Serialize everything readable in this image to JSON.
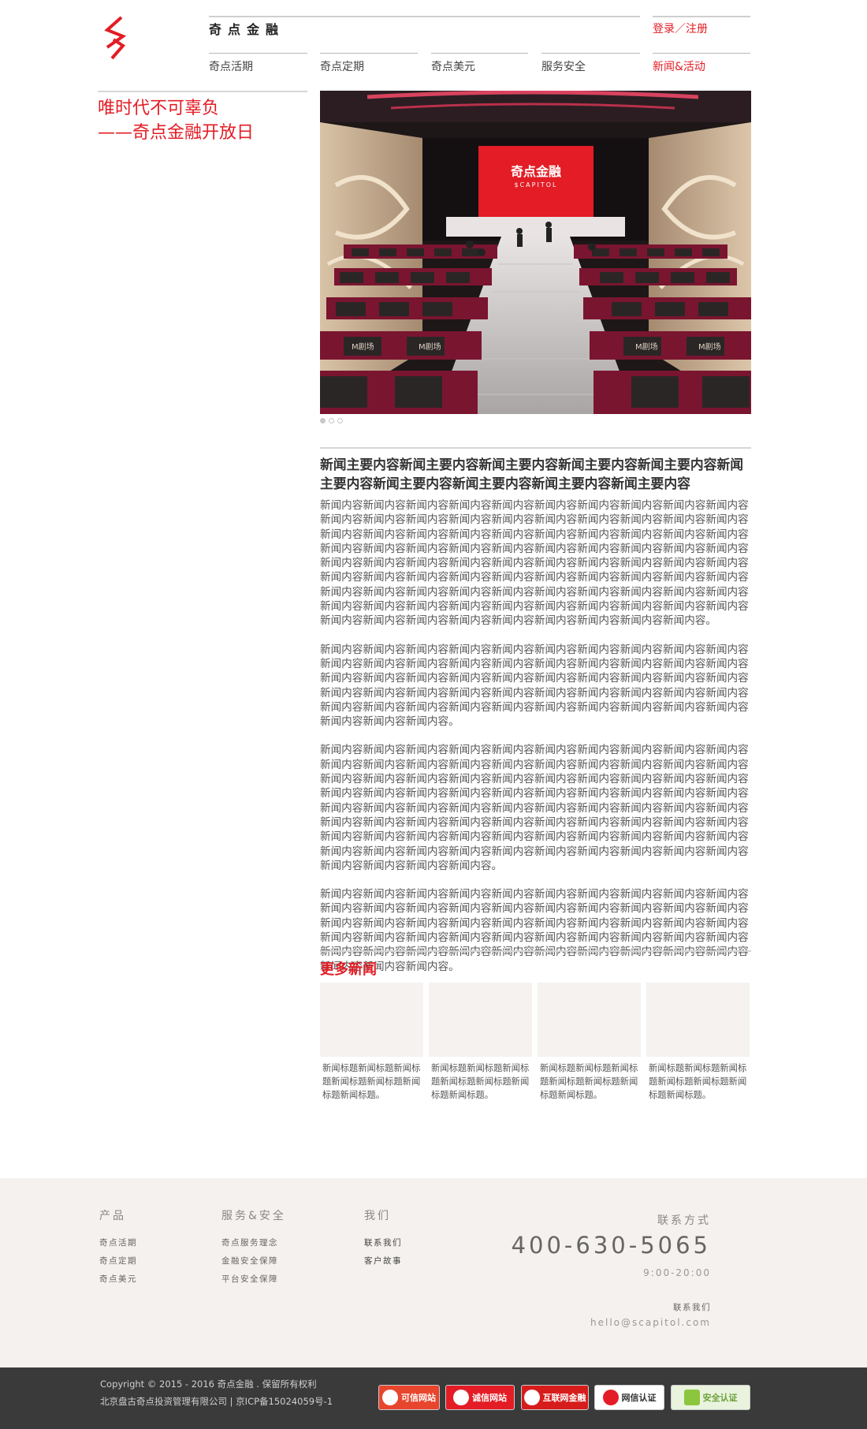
{
  "header": {
    "brand": "奇点金融",
    "login": "登录／注册",
    "nav": [
      "奇点活期",
      "奇点定期",
      "奇点美元",
      "服务安全",
      "新闻&活动"
    ]
  },
  "slogan": {
    "line1": "唯时代不可辜负",
    "line2": "——奇点金融开放日"
  },
  "hero": {
    "screen_title": "奇点金融",
    "screen_sub": "$CAPITOL",
    "seat_label": "M剧场"
  },
  "article": {
    "title": "新闻主要内容新闻主要内容新闻主要内容新闻主要内容新闻主要内容新闻主要内容新闻主要内容新闻主要内容新闻主要内容新闻主要内容",
    "paragraphs": [
      "新闻内容新闻内容新闻内容新闻内容新闻内容新闻内容新闻内容新闻内容新闻内容新闻内容新闻内容新闻内容新闻内容新闻内容新闻内容新闻内容新闻内容新闻内容新闻内容新闻内容新闻内容新闻内容新闻内容新闻内容新闻内容新闻内容新闻内容新闻内容新闻内容新闻内容新闻内容新闻内容新闻内容新闻内容新闻内容新闻内容新闻内容新闻内容新闻内容新闻内容新闻内容新闻内容新闻内容新闻内容新闻内容新闻内容新闻内容新闻内容新闻内容新闻内容新闻内容新闻内容新闻内容新闻内容新闻内容新闻内容新闻内容新闻内容新闻内容新闻内容新闻内容新闻内容新闻内容新闻内容新闻内容新闻内容新闻内容新闻内容新闻内容新闻内容新闻内容新闻内容新闻内容新闻内容新闻内容新闻内容新闻内容新闻内容新闻内容新闻内容新闻内容新闻内容新闻内容新闻内容新闻内容新闻内容新闻内容新闻内容新闻内容。",
      "新闻内容新闻内容新闻内容新闻内容新闻内容新闻内容新闻内容新闻内容新闻内容新闻内容新闻内容新闻内容新闻内容新闻内容新闻内容新闻内容新闻内容新闻内容新闻内容新闻内容新闻内容新闻内容新闻内容新闻内容新闻内容新闻内容新闻内容新闻内容新闻内容新闻内容新闻内容新闻内容新闻内容新闻内容新闻内容新闻内容新闻内容新闻内容新闻内容新闻内容新闻内容新闻内容新闻内容新闻内容新闻内容新闻内容新闻内容新闻内容新闻内容新闻内容新闻内容新闻内容新闻内容。",
      "新闻内容新闻内容新闻内容新闻内容新闻内容新闻内容新闻内容新闻内容新闻内容新闻内容新闻内容新闻内容新闻内容新闻内容新闻内容新闻内容新闻内容新闻内容新闻内容新闻内容新闻内容新闻内容新闻内容新闻内容新闻内容新闻内容新闻内容新闻内容新闻内容新闻内容新闻内容新闻内容新闻内容新闻内容新闻内容新闻内容新闻内容新闻内容新闻内容新闻内容新闻内容新闻内容新闻内容新闻内容新闻内容新闻内容新闻内容新闻内容新闻内容新闻内容新闻内容新闻内容新闻内容新闻内容新闻内容新闻内容新闻内容新闻内容新闻内容新闻内容新闻内容新闻内容新闻内容新闻内容新闻内容新闻内容新闻内容新闻内容新闻内容新闻内容新闻内容新闻内容新闻内容新闻内容新闻内容新闻内容新闻内容新闻内容新闻内容新闻内容新闻内容新闻内容新闻内容新闻内容。",
      "新闻内容新闻内容新闻内容新闻内容新闻内容新闻内容新闻内容新闻内容新闻内容新闻内容新闻内容新闻内容新闻内容新闻内容新闻内容新闻内容新闻内容新闻内容新闻内容新闻内容新闻内容新闻内容新闻内容新闻内容新闻内容新闻内容新闻内容新闻内容新闻内容新闻内容新闻内容新闻内容新闻内容新闻内容新闻内容新闻内容新闻内容新闻内容新闻内容新闻内容新闻内容新闻内容新闻内容新闻内容新闻内容新闻内容新闻内容新闻内容新闻内容新闻内容新闻内容新闻内容新闻内容。"
    ]
  },
  "more_news": {
    "title": "更多新闻",
    "items": [
      "新闻标题新闻标题新闻标题新闻标题新闻标题新闻标题新闻标题。",
      "新闻标题新闻标题新闻标题新闻标题新闻标题新闻标题新闻标题。",
      "新闻标题新闻标题新闻标题新闻标题新闻标题新闻标题新闻标题。",
      "新闻标题新闻标题新闻标题新闻标题新闻标题新闻标题新闻标题。"
    ]
  },
  "footer": {
    "products": {
      "title": "产品",
      "links": [
        "奇点活期",
        "奇点定期",
        "奇点美元"
      ]
    },
    "service": {
      "title": "服务&安全",
      "links": [
        "奇点服务理念",
        "金融安全保障",
        "平台安全保障"
      ]
    },
    "about": {
      "title": "我们",
      "links": [
        "联系我们",
        "客户故事"
      ]
    },
    "contact": {
      "title": "联系方式",
      "phone": "400-630-5065",
      "hours": "9:00-20:00",
      "contact_label": "联系我们",
      "email": "hello@scapitol.com"
    },
    "copyright": "Copyright © 2015 - 2016 奇点金融 . 保留所有权利",
    "icp": "北京盘古奇点投资管理有限公司  |  京ICP备15024059号-1",
    "badges": [
      {
        "label": "可信网站",
        "color": "#e8452d"
      },
      {
        "label": "诚信网站",
        "color": "#e31c25"
      },
      {
        "label": "互联网金融",
        "color": "#d71c1c"
      },
      {
        "label": "网信认证",
        "color": "#ffffff"
      },
      {
        "label": "安全认证",
        "color": "#e9f3dd"
      }
    ]
  },
  "colors": {
    "accent": "#e31c25",
    "footer_bg": "#f4f1ee",
    "bottom_bg": "#3a3a3a"
  }
}
